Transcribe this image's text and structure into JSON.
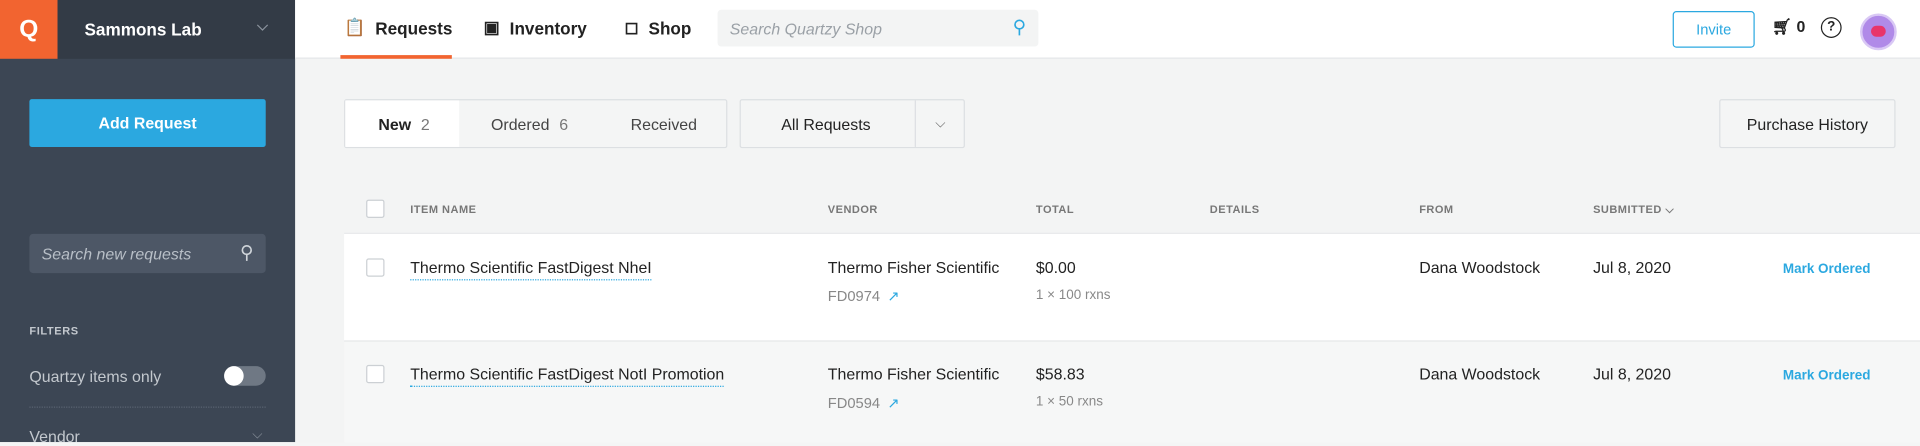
{
  "sidebar": {
    "logo": "Q",
    "lab": "Sammons Lab",
    "add_request": "Add Request",
    "search_placeholder": "Search new requests",
    "filters_label": "FILTERS",
    "quartzy_only": "Quartzy items only",
    "vendor": "Vendor"
  },
  "topbar": {
    "nav": [
      {
        "label": "Requests"
      },
      {
        "label": "Inventory"
      },
      {
        "label": "Shop"
      }
    ],
    "shop_search_placeholder": "Search Quartzy Shop",
    "invite": "Invite",
    "cart_count": "0",
    "help": "?"
  },
  "tabs": [
    {
      "label": "New",
      "count": "2"
    },
    {
      "label": "Ordered",
      "count": "6"
    },
    {
      "label": "Received"
    }
  ],
  "filter_select": "All Requests",
  "purchase_history": "Purchase History",
  "table": {
    "headers": [
      "ITEM NAME",
      "VENDOR",
      "TOTAL",
      "DETAILS",
      "FROM",
      "SUBMITTED"
    ],
    "rows": [
      {
        "item": "Thermo Scientific FastDigest NheI",
        "vendor": "Thermo Fisher Scientific",
        "catalog": "FD0974",
        "total": "$0.00",
        "qty": "1 × 100 rxns",
        "details": "",
        "from": "Dana Woodstock",
        "submitted": "Jul 8, 2020",
        "action": "Mark Ordered"
      },
      {
        "item": "Thermo Scientific FastDigest NotI Promotion",
        "vendor": "Thermo Fisher Scientific",
        "catalog": "FD0594",
        "total": "$58.83",
        "qty": "1 × 50 rxns",
        "details": "",
        "from": "Dana Woodstock",
        "submitted": "Jul 8, 2020",
        "action": "Mark Ordered"
      }
    ]
  },
  "colors": {
    "brand": "#f26430",
    "accent": "#2ba8e0",
    "sidebar": "#3c4654"
  }
}
